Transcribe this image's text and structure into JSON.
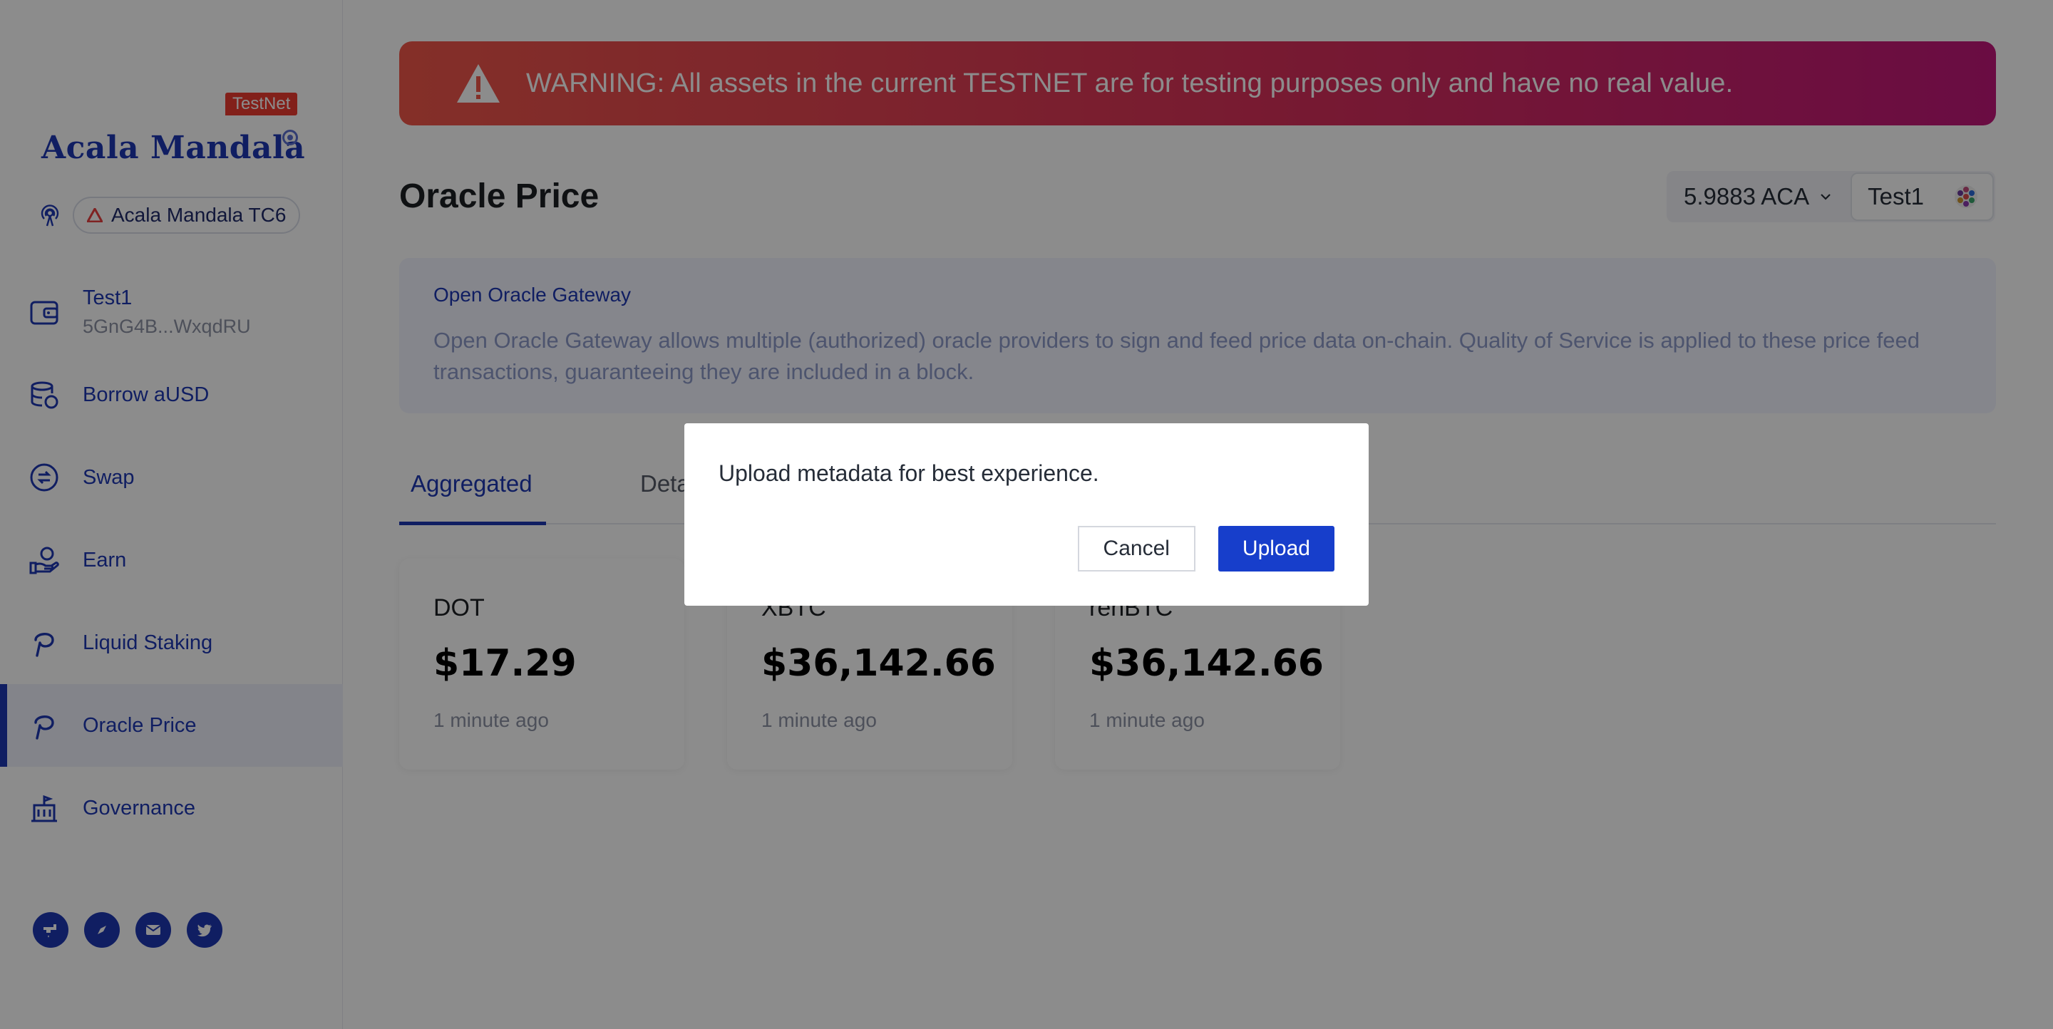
{
  "brand": {
    "badge": "TestNet",
    "logo_text": "Acala Mandala",
    "network_name": "Acala Mandala TC6"
  },
  "account": {
    "name": "Test1",
    "address": "5GnG4B...WxqdRU"
  },
  "nav": {
    "items": [
      {
        "label": "Borrow aUSD",
        "icon": "database-icon"
      },
      {
        "label": "Swap",
        "icon": "swap-icon"
      },
      {
        "label": "Earn",
        "icon": "earn-hand-icon"
      },
      {
        "label": "Liquid Staking",
        "icon": "polkadot-p-icon"
      },
      {
        "label": "Oracle Price",
        "icon": "polkadot-p-icon",
        "active": true
      },
      {
        "label": "Governance",
        "icon": "governance-building-icon"
      }
    ]
  },
  "social": [
    "faucet-icon",
    "compass-icon",
    "mail-icon",
    "twitter-icon"
  ],
  "warning": {
    "text": "WARNING: All assets in the current TESTNET are for testing purposes only and have no real value."
  },
  "header": {
    "title": "Oracle Price",
    "balance": "5.9883 ACA",
    "account_name": "Test1"
  },
  "info": {
    "title": "Open Oracle Gateway",
    "text": "Open Oracle Gateway allows multiple (authorized) oracle providers to sign and feed price data on-chain. Quality of Service is applied to these price feed transactions, guaranteeing they are included in a block."
  },
  "tabs": [
    {
      "label": "Aggregated",
      "active": true
    },
    {
      "label": "Deta",
      "active": false
    }
  ],
  "prices": [
    {
      "token": "DOT",
      "price": "$17.29",
      "time": "1 minute ago"
    },
    {
      "token": "XBTC",
      "price": "$36,142.66",
      "time": "1 minute ago"
    },
    {
      "token": "renBTC",
      "price": "$36,142.66",
      "time": "1 minute ago"
    }
  ],
  "modal": {
    "message": "Upload metadata for best experience.",
    "cancel_label": "Cancel",
    "upload_label": "Upload"
  },
  "colors": {
    "brand_blue": "#1e37b3",
    "warning_start": "#f0574a",
    "warning_end": "#c1177a",
    "upload_button": "#173ecb"
  }
}
